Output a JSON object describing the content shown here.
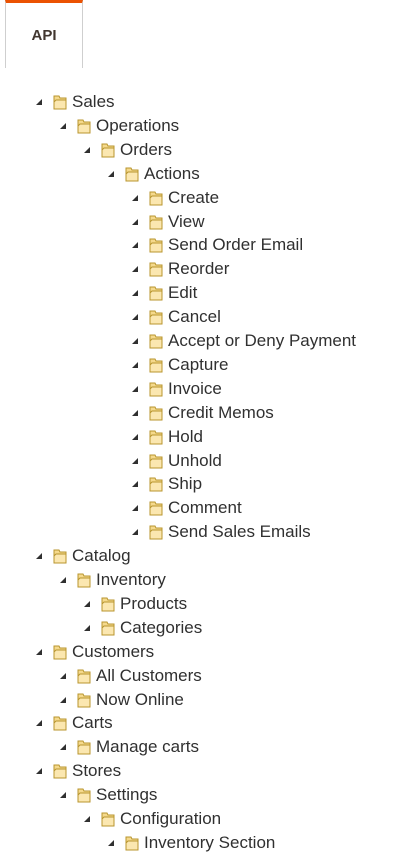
{
  "tabs": [
    {
      "label": "API"
    }
  ],
  "tree": [
    {
      "label": "Sales",
      "level": 0,
      "expanded": true
    },
    {
      "label": "Operations",
      "level": 1,
      "expanded": true
    },
    {
      "label": "Orders",
      "level": 2,
      "expanded": true
    },
    {
      "label": "Actions",
      "level": 3,
      "expanded": true
    },
    {
      "label": "Create",
      "level": 4,
      "expanded": true
    },
    {
      "label": "View",
      "level": 4,
      "expanded": true
    },
    {
      "label": "Send Order Email",
      "level": 4,
      "expanded": true
    },
    {
      "label": "Reorder",
      "level": 4,
      "expanded": true
    },
    {
      "label": "Edit",
      "level": 4,
      "expanded": true
    },
    {
      "label": "Cancel",
      "level": 4,
      "expanded": true
    },
    {
      "label": "Accept or Deny Payment",
      "level": 4,
      "expanded": true
    },
    {
      "label": "Capture",
      "level": 4,
      "expanded": true
    },
    {
      "label": "Invoice",
      "level": 4,
      "expanded": true
    },
    {
      "label": "Credit Memos",
      "level": 4,
      "expanded": true
    },
    {
      "label": "Hold",
      "level": 4,
      "expanded": true
    },
    {
      "label": "Unhold",
      "level": 4,
      "expanded": true
    },
    {
      "label": "Ship",
      "level": 4,
      "expanded": true
    },
    {
      "label": "Comment",
      "level": 4,
      "expanded": true
    },
    {
      "label": "Send Sales Emails",
      "level": 4,
      "expanded": true
    },
    {
      "label": "Catalog",
      "level": 0,
      "expanded": true
    },
    {
      "label": "Inventory",
      "level": 1,
      "expanded": true
    },
    {
      "label": "Products",
      "level": 2,
      "expanded": true
    },
    {
      "label": "Categories",
      "level": 2,
      "expanded": true
    },
    {
      "label": "Customers",
      "level": 0,
      "expanded": true
    },
    {
      "label": "All Customers",
      "level": 1,
      "expanded": true
    },
    {
      "label": "Now Online",
      "level": 1,
      "expanded": true
    },
    {
      "label": "Carts",
      "level": 0,
      "expanded": true
    },
    {
      "label": "Manage carts",
      "level": 1,
      "expanded": true
    },
    {
      "label": "Stores",
      "level": 0,
      "expanded": true
    },
    {
      "label": "Settings",
      "level": 1,
      "expanded": true
    },
    {
      "label": "Configuration",
      "level": 2,
      "expanded": true
    },
    {
      "label": "Inventory Section",
      "level": 3,
      "expanded": true
    }
  ],
  "colors": {
    "tab_accent": "#eb5202",
    "folder_fill": "#f5d98c",
    "folder_stroke": "#b8952e",
    "text": "#303030"
  }
}
